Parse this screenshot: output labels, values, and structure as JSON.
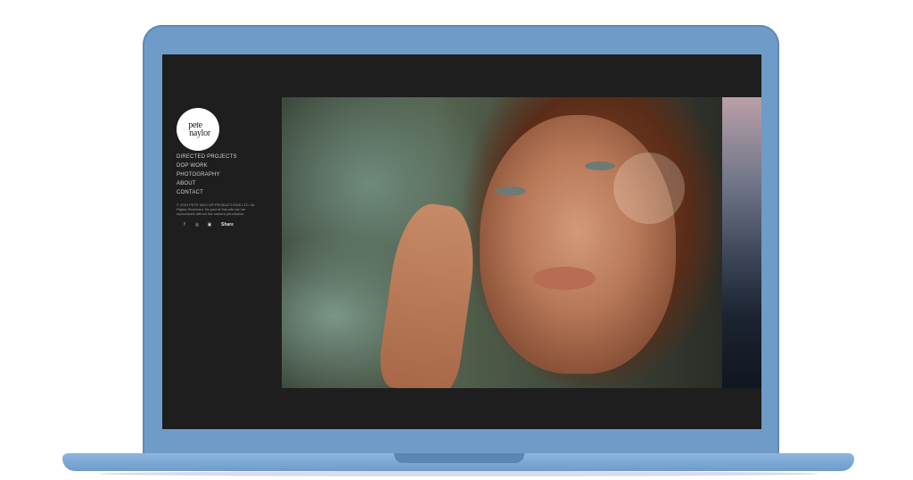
{
  "brand": {
    "logo_line1": "pete",
    "logo_line2": "naylor"
  },
  "nav": {
    "items": [
      {
        "label": "DIRECTED PROJECTS"
      },
      {
        "label": "DOP WORK"
      },
      {
        "label": "PHOTOGRAPHY"
      },
      {
        "label": "ABOUT"
      },
      {
        "label": "CONTACT"
      }
    ]
  },
  "footer": {
    "copyright": "© 2023 PETE NAYLOR PRODUCTIONS LTD. All Rights Reserved. No part of this site can be reproduced without the owners permission.",
    "social_icons": [
      "facebook-icon",
      "instagram-icon",
      "vimeo-icon"
    ],
    "social_glyphs": [
      "f",
      "◎",
      "▣"
    ],
    "share_label": "Share"
  },
  "colors": {
    "device": "#6f9bc9",
    "screen_bg": "#1e1e1f",
    "nav_text": "#cfcfcf"
  }
}
